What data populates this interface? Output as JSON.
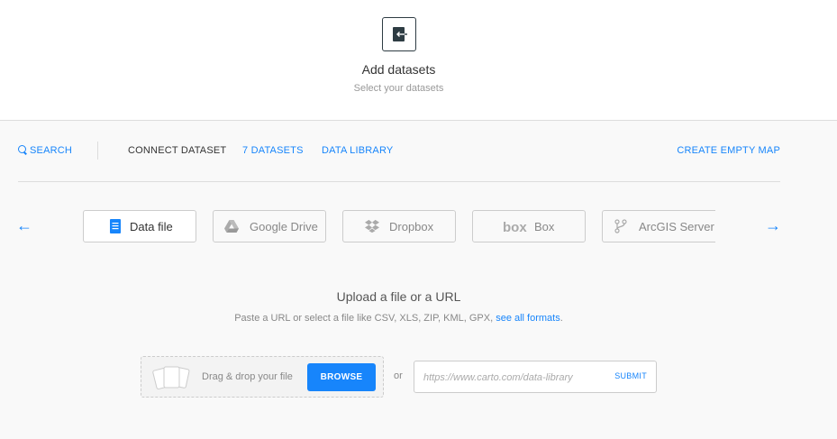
{
  "header": {
    "title": "Add datasets",
    "subtitle": "Select your datasets",
    "icon": "import-file-icon"
  },
  "nav": {
    "search": "SEARCH",
    "connect": "CONNECT DATASET",
    "datasets": "7 DATASETS",
    "library": "DATA LIBRARY",
    "empty_map": "CREATE EMPTY MAP"
  },
  "tabs": [
    {
      "label": "Data file",
      "icon": "document-icon",
      "active": true
    },
    {
      "label": "Google Drive",
      "icon": "google-drive-icon",
      "active": false
    },
    {
      "label": "Dropbox",
      "icon": "dropbox-icon",
      "active": false
    },
    {
      "label": "Box",
      "icon": "box-icon",
      "active": false
    },
    {
      "label": "ArcGIS Server™",
      "icon": "arcgis-icon",
      "active": false
    }
  ],
  "upload": {
    "title": "Upload a file or a URL",
    "subtitle_prefix": "Paste a URL or select a file like CSV, XLS, ZIP, KML, GPX,",
    "subtitle_link": "see all formats",
    "subtitle_suffix": ".",
    "drag_text": "Drag & drop your file",
    "browse_label": "BROWSE",
    "or_text": "or",
    "url_placeholder": "https://www.carto.com/data-library",
    "submit_label": "SUBMIT"
  },
  "colors": {
    "accent": "#1785fb",
    "dark": "#2e3c43"
  }
}
